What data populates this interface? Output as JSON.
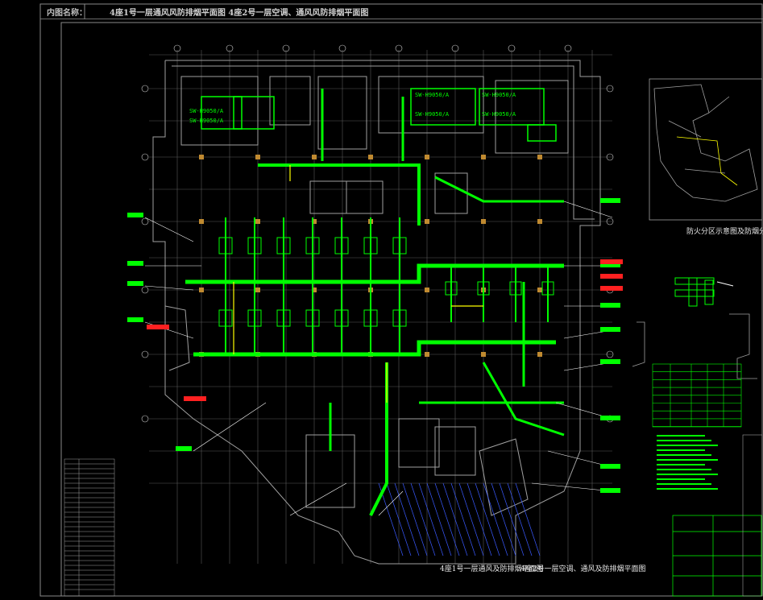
{
  "title_block": {
    "label": "内图名称：",
    "text": "4座1号一层通风风防排烟平面图 4座2号一层空调、通风风防排烟平面图"
  },
  "plan_captions": {
    "left": "4座1号一层通风及防排烟平面图",
    "right": "4座2号一层空调、通风及防排烟平面图"
  },
  "key_plan_caption": "防火分区示意图及防烟分区示意图",
  "equipment_tags": [
    "SW-H9050/A",
    "SW-H9050/A",
    "SW-H9050/A",
    "SW-H9050/A",
    "SW-H9050/A",
    "SW-H9050/A"
  ],
  "colors": {
    "background": "#000000",
    "duct": "#00ff00",
    "wall": "#a0a0a0",
    "axis": "#ffffff",
    "leader": "#ffffff",
    "annotation": "#ff2020",
    "hatch": "#3a5aff",
    "accent": "#ffff00",
    "column": "#c08a30"
  },
  "icons": {
    "plan": "hvac-floor-plan",
    "table": "equipment-schedule-table"
  }
}
